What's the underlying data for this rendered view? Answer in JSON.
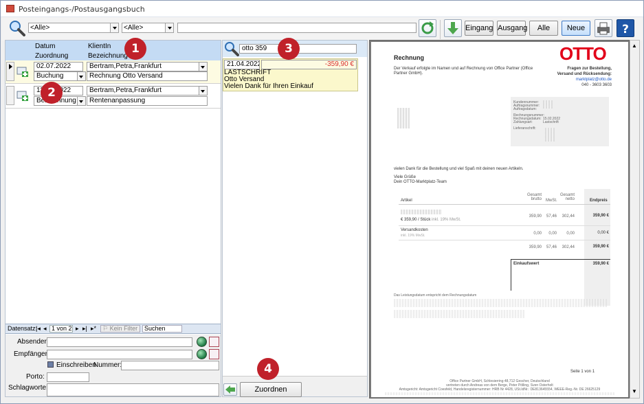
{
  "window": {
    "title": "Posteingangs-/Postausgangsbuch"
  },
  "toolbar": {
    "filter1": "<Alle>",
    "filter2": "<Alle>",
    "search_value": "",
    "eingang": "Eingang",
    "ausgang": "Ausgang",
    "alle": "Alle",
    "neu": "Neue"
  },
  "left": {
    "headers": {
      "datum": "Datum",
      "klientin": "KlientIn",
      "zuordnung": "Zuordnung",
      "bezeichnung": "Bezeichnung"
    },
    "rows": [
      {
        "date": "02.07.2022",
        "client": "Bertram,Petra,Frankfurt",
        "type": "Buchung",
        "title": "Rechnung Otto Versand"
      },
      {
        "date": "13.05.2022",
        "client": "Bertram,Petra,Frankfurt",
        "type": "Bezeichnung",
        "title": "Rentenanpassung"
      }
    ],
    "nav": {
      "label": "Datensatz:",
      "position": "1 von 2",
      "filter": "Kein Filter",
      "search": "Suchen"
    },
    "form": {
      "absender": "Absender:",
      "empfaenger": "Empfänger:",
      "einschreiben": "Einschreiben",
      "nummer": "Nummer:",
      "porto": "Porto:",
      "schlagworte": "Schlagworte:"
    }
  },
  "middle": {
    "search_value": "otto 359",
    "result": {
      "date": "21.04.2022",
      "amount": "-359,90 €",
      "line1": "LASTSCHRIFT",
      "line2": "Otto Versand",
      "line3": "Vielen Dank für Ihren Einkauf"
    },
    "assign_button": "Zuordnen"
  },
  "badges": [
    "1",
    "2",
    "3",
    "4"
  ],
  "document": {
    "logo": "OTTO",
    "title": "Rechnung",
    "intro": "Der Verkauf erfolgte im Namen und auf Rechnung von Office Partner (Office Partner GmbH).",
    "contact": {
      "line1": "Fragen zur Bestellung,",
      "line2": "Versand und Rücksendung:",
      "email": "marktplatz@otto.de",
      "phone": "040 - 3603 3603"
    },
    "info_labels": [
      "Kundennummer:",
      "Auftragsnummer:",
      "Auftragsdatum:",
      "Rechnungsnummer:",
      "Rechnungsdatum:",
      "Zahlungsart:",
      "Lieferanschrift:"
    ],
    "info_values": {
      "date": "15.02.2022",
      "payment": "Lastschrift"
    },
    "thanks": "vielen Dank für die Bestellung und viel Spaß mit deinen neuen Artikeln.",
    "greeting": "Viele Grüße",
    "team": "Dein OTTO-Marktplatz-Team",
    "table": {
      "col_artikel": "Artikel",
      "col_gesamt_brutto": "Gesamt brutto",
      "col_mwst": "MwSt.",
      "col_gesamt_netto": "Gesamt netto",
      "col_endpreis": "Endpreis",
      "row1": {
        "price_note": "€ 359,90 / Stück",
        "vat_note": "inkl. 19% MwSt.",
        "brutto": "359,90",
        "mwst": "57,46",
        "netto": "302,44",
        "end": "359,90 €"
      },
      "row2": {
        "label": "Versandkosten",
        "vat_note": "inkl. 19% MwSt.",
        "brutto": "0,00",
        "mwst": "0,00",
        "netto": "0,00",
        "end": "0,00 €"
      },
      "row3": {
        "brutto": "359,90",
        "mwst": "57,46",
        "netto": "302,44",
        "end": "359,90 €"
      },
      "total_label": "Einkaufswert",
      "total_value": "359,90 €"
    },
    "footnote1": "Das Leistungsdatum entspricht dem Rechnungsdatum",
    "page": "Seite 1 von 1",
    "footer1": "Office Partner GmbH, Schlesierring 48,712 Gescher, Deutschland",
    "footer2": "vertreten durch Andreas von dem Berge, Peter Pölling, Sven Osterholt",
    "footer3": "Amtsgericht: Amtsgericht Coesfeld, Handelsregisternummer: HRB Nr 4428, USt.IdNr.: DE813645554, WEEE-Reg.-Nr. DE 26625129"
  }
}
